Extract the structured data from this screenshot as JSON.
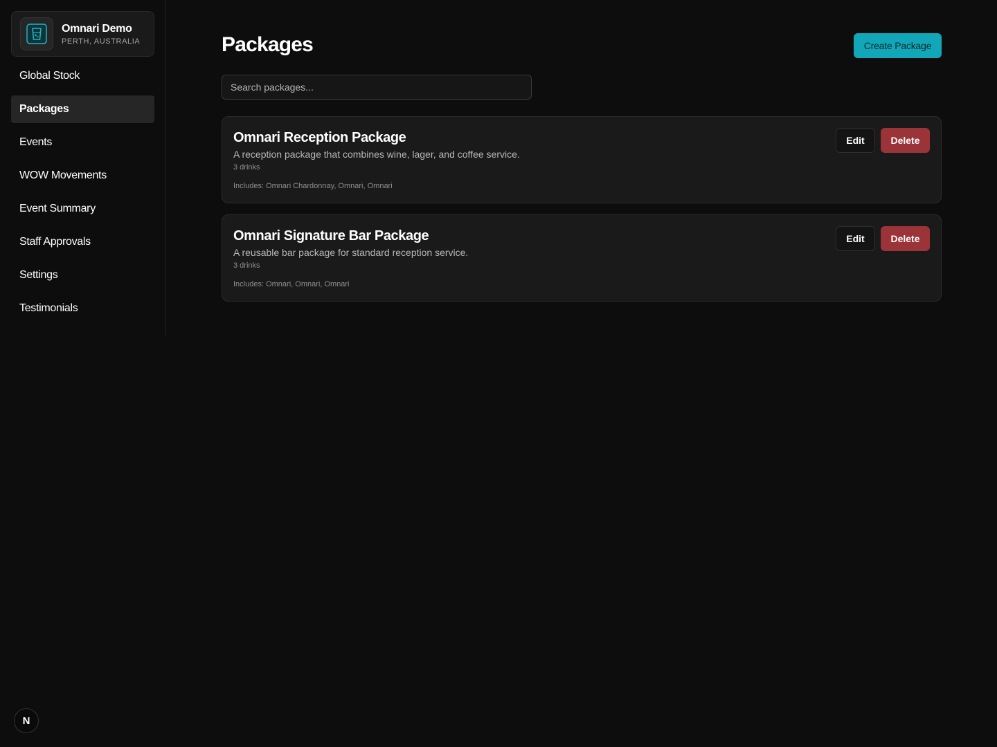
{
  "org": {
    "name": "Omnari Demo",
    "location": "PERTH, AUSTRALIA",
    "logo_icon": "glass-icon"
  },
  "sidebar": {
    "items": [
      {
        "label": "Global Stock",
        "active": false
      },
      {
        "label": "Packages",
        "active": true
      },
      {
        "label": "Events",
        "active": false
      },
      {
        "label": "WOW Movements",
        "active": false
      },
      {
        "label": "Event Summary",
        "active": false
      },
      {
        "label": "Staff Approvals",
        "active": false
      },
      {
        "label": "Settings",
        "active": false
      },
      {
        "label": "Testimonials",
        "active": false
      }
    ]
  },
  "header": {
    "title": "Packages",
    "create_label": "Create Package"
  },
  "search": {
    "placeholder": "Search packages...",
    "value": ""
  },
  "packages": [
    {
      "name": "Omnari Reception Package",
      "description": "A reception package that combines wine, lager, and coffee service.",
      "drinks": "3 drinks",
      "includes": "Includes: Omnari Chardonnay, Omnari, Omnari",
      "edit_label": "Edit",
      "delete_label": "Delete"
    },
    {
      "name": "Omnari Signature Bar Package",
      "description": "A reusable bar package for standard reception service.",
      "drinks": "3 drinks",
      "includes": "Includes: Omnari, Omnari, Omnari",
      "edit_label": "Edit",
      "delete_label": "Delete"
    }
  ],
  "dev_badge": {
    "label": "N"
  },
  "colors": {
    "accent": "#12a7b8",
    "danger": "#9b3438",
    "background": "#0d0d0d"
  }
}
